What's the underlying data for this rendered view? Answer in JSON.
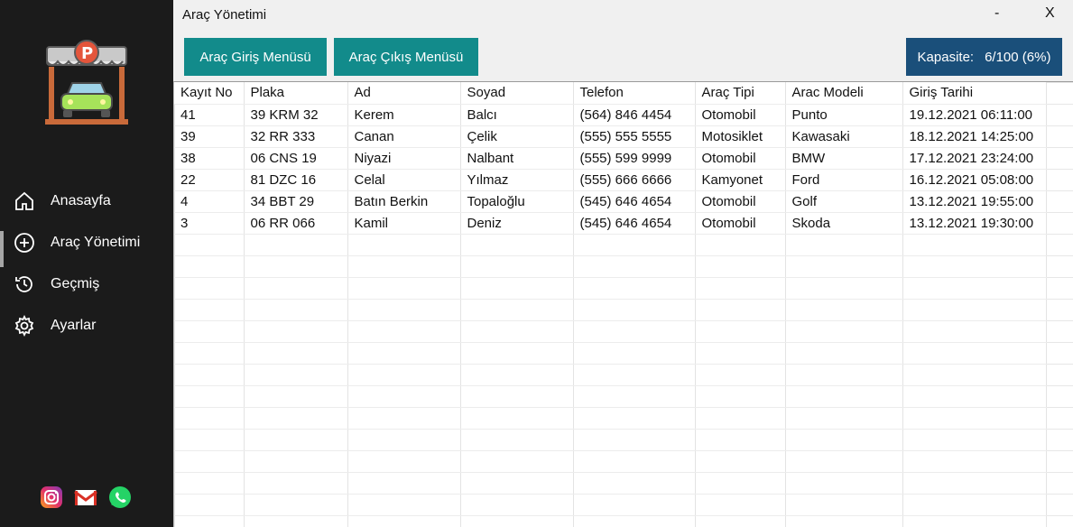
{
  "window": {
    "title": "Araç Yönetimi",
    "minimize": "-",
    "close": "X"
  },
  "sidebar": {
    "items": [
      {
        "label": "Anasayfa",
        "icon": "home-icon"
      },
      {
        "label": "Araç Yönetimi",
        "icon": "plus-circle-icon"
      },
      {
        "label": "Geçmiş",
        "icon": "history-icon"
      },
      {
        "label": "Ayarlar",
        "icon": "gear-icon"
      }
    ],
    "social": [
      "instagram-icon",
      "gmail-icon",
      "whatsapp-icon"
    ]
  },
  "toolbar": {
    "entry_label": "Araç Giriş Menüsü",
    "exit_label": "Araç Çıkış Menüsü",
    "capacity_label": "Kapasite:",
    "capacity_value": "6/100 (6%)"
  },
  "table": {
    "headers": [
      "Kayıt No",
      "Plaka",
      "Ad",
      "Soyad",
      "Telefon",
      "Araç Tipi",
      "Arac Modeli",
      "Giriş Tarihi"
    ],
    "rows": [
      [
        "41",
        "39 KRM 32",
        "Kerem",
        "Balcı",
        "(564) 846 4454",
        "Otomobil",
        "Punto",
        "19.12.2021 06:11:00"
      ],
      [
        "39",
        "32 RR 333",
        "Canan",
        "Çelik",
        "(555) 555 5555",
        "Motosiklet",
        "Kawasaki",
        "18.12.2021 14:25:00"
      ],
      [
        "38",
        "06 CNS 19",
        "Niyazi",
        "Nalbant",
        "(555) 599 9999",
        "Otomobil",
        "BMW",
        "17.12.2021 23:24:00"
      ],
      [
        "22",
        "81 DZC 16",
        "Celal",
        "Yılmaz",
        "(555) 666 6666",
        "Kamyonet",
        "Ford",
        "16.12.2021 05:08:00"
      ],
      [
        "4",
        "34 BBT 29",
        "Batın Berkin",
        "Topaloğlu",
        "(545) 646 4654",
        "Otomobil",
        "Golf",
        "13.12.2021 19:55:00"
      ],
      [
        "3",
        "06 RR 066",
        "Kamil",
        "Deniz",
        "(545) 646 4654",
        "Otomobil",
        "Skoda",
        "13.12.2021 19:30:00"
      ]
    ]
  },
  "colors": {
    "sidebar": "#1b1b1b",
    "teal_button": "#128b8b",
    "capacity_bg": "#1a4f7a"
  }
}
